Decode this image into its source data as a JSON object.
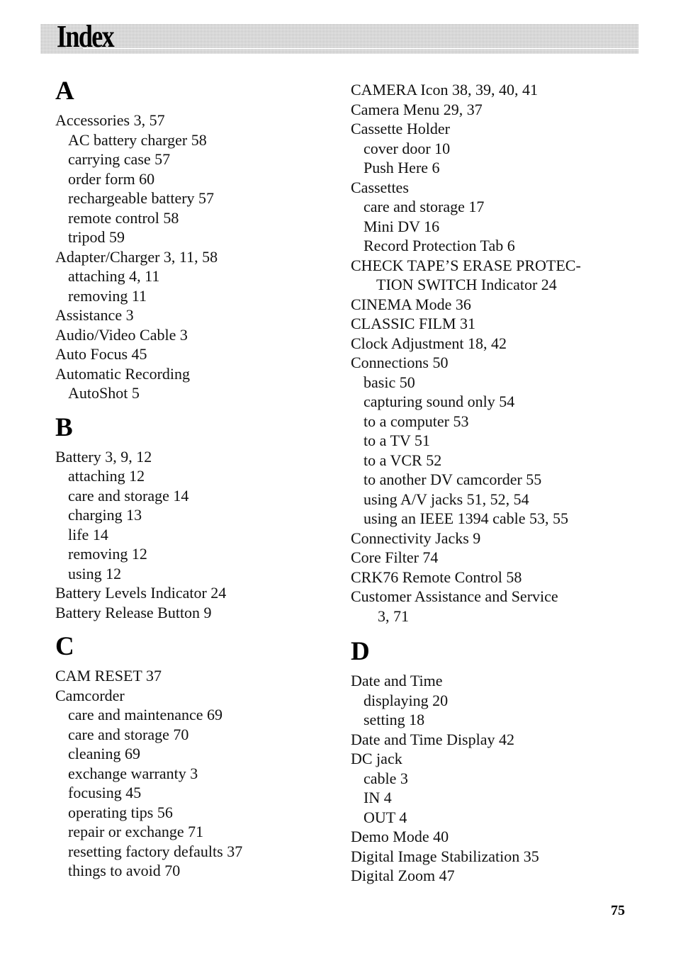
{
  "header": {
    "title": "Index"
  },
  "page_number": "75",
  "columns": [
    {
      "sections": [
        {
          "letter": "A",
          "entries": [
            {
              "text": "Accessories  3,  57",
              "level": 0
            },
            {
              "text": "AC battery charger  58",
              "level": 1
            },
            {
              "text": "carrying case  57",
              "level": 1
            },
            {
              "text": "order form  60",
              "level": 1
            },
            {
              "text": "rechargeable battery  57",
              "level": 1
            },
            {
              "text": "remote control  58",
              "level": 1
            },
            {
              "text": "tripod  59",
              "level": 1
            },
            {
              "text": "Adapter/Charger  3,  11,  58",
              "level": 0
            },
            {
              "text": "attaching  4,  11",
              "level": 1
            },
            {
              "text": "removing  11",
              "level": 1
            },
            {
              "text": "Assistance  3",
              "level": 0
            },
            {
              "text": "Audio/Video Cable  3",
              "level": 0
            },
            {
              "text": "Auto Focus  45",
              "level": 0
            },
            {
              "text": "Automatic Recording",
              "level": 0
            },
            {
              "text": "AutoShot  5",
              "level": 1
            }
          ]
        },
        {
          "letter": "B",
          "entries": [
            {
              "text": "Battery  3,  9,  12",
              "level": 0
            },
            {
              "text": "attaching  12",
              "level": 1
            },
            {
              "text": "care and storage  14",
              "level": 1
            },
            {
              "text": "charging  13",
              "level": 1
            },
            {
              "text": "life  14",
              "level": 1
            },
            {
              "text": "removing  12",
              "level": 1
            },
            {
              "text": "using  12",
              "level": 1
            },
            {
              "text": "Battery Levels Indicator  24",
              "level": 0
            },
            {
              "text": "Battery Release Button  9",
              "level": 0
            }
          ]
        },
        {
          "letter": "C",
          "entries": [
            {
              "text": "CAM RESET  37",
              "level": 0
            },
            {
              "text": "Camcorder",
              "level": 0
            },
            {
              "text": "care and maintenance  69",
              "level": 1
            },
            {
              "text": "care and storage  70",
              "level": 1
            },
            {
              "text": "cleaning  69",
              "level": 1
            },
            {
              "text": "exchange warranty  3",
              "level": 1
            },
            {
              "text": "focusing  45",
              "level": 1
            },
            {
              "text": "operating tips  56",
              "level": 1
            },
            {
              "text": "repair or exchange  71",
              "level": 1
            },
            {
              "text": "resetting factory defaults  37",
              "level": 1
            },
            {
              "text": "things to avoid  70",
              "level": 1
            }
          ]
        }
      ]
    },
    {
      "sections": [
        {
          "letter": "",
          "entries": [
            {
              "text": "CAMERA Icon  38,  39,  40,  41",
              "level": 0
            },
            {
              "text": "Camera Menu  29,  37",
              "level": 0
            },
            {
              "text": "Cassette Holder",
              "level": 0
            },
            {
              "text": "cover door  10",
              "level": 1
            },
            {
              "text": "Push Here  6",
              "level": 1
            },
            {
              "text": "Cassettes",
              "level": 0
            },
            {
              "text": "care and storage  17",
              "level": 1
            },
            {
              "text": "Mini DV  16",
              "level": 1
            },
            {
              "text": "Record Protection Tab  6",
              "level": 1
            },
            {
              "text": "CHECK TAPE’S ERASE PROTEC-",
              "level": 0
            },
            {
              "text": "TION SWITCH Indicator  24",
              "level": 2
            },
            {
              "text": "CINEMA Mode  36",
              "level": 0
            },
            {
              "text": "CLASSIC FILM  31",
              "level": 0
            },
            {
              "text": "Clock Adjustment  18,  42",
              "level": 0
            },
            {
              "text": "Connections  50",
              "level": 0
            },
            {
              "text": "basic  50",
              "level": 1
            },
            {
              "text": "capturing sound only  54",
              "level": 1
            },
            {
              "text": "to a computer  53",
              "level": 1
            },
            {
              "text": "to a TV  51",
              "level": 1
            },
            {
              "text": "to a VCR  52",
              "level": 1
            },
            {
              "text": "to another DV camcorder  55",
              "level": 1
            },
            {
              "text": "using A/V jacks  51,  52,  54",
              "level": 1
            },
            {
              "text": "using an IEEE 1394 cable  53,  55",
              "level": 1
            },
            {
              "text": "Connectivity Jacks  9",
              "level": 0
            },
            {
              "text": "Core Filter  74",
              "level": 0
            },
            {
              "text": "CRK76 Remote Control  58",
              "level": 0
            },
            {
              "text": "Customer Assistance and Service",
              "level": 0
            },
            {
              "text": "3,  71",
              "level": 3
            }
          ]
        },
        {
          "letter": "D",
          "entries": [
            {
              "text": "Date and Time",
              "level": 0
            },
            {
              "text": "displaying  20",
              "level": 1
            },
            {
              "text": "setting  18",
              "level": 1
            },
            {
              "text": "Date and Time Display  42",
              "level": 0
            },
            {
              "text": "DC jack",
              "level": 0
            },
            {
              "text": "cable  3",
              "level": 1
            },
            {
              "text": "IN  4",
              "level": 1
            },
            {
              "text": "OUT  4",
              "level": 1
            },
            {
              "text": "Demo Mode  40",
              "level": 0
            },
            {
              "text": "Digital Image Stabilization  35",
              "level": 0
            },
            {
              "text": "Digital Zoom  47",
              "level": 0
            }
          ]
        }
      ]
    }
  ]
}
